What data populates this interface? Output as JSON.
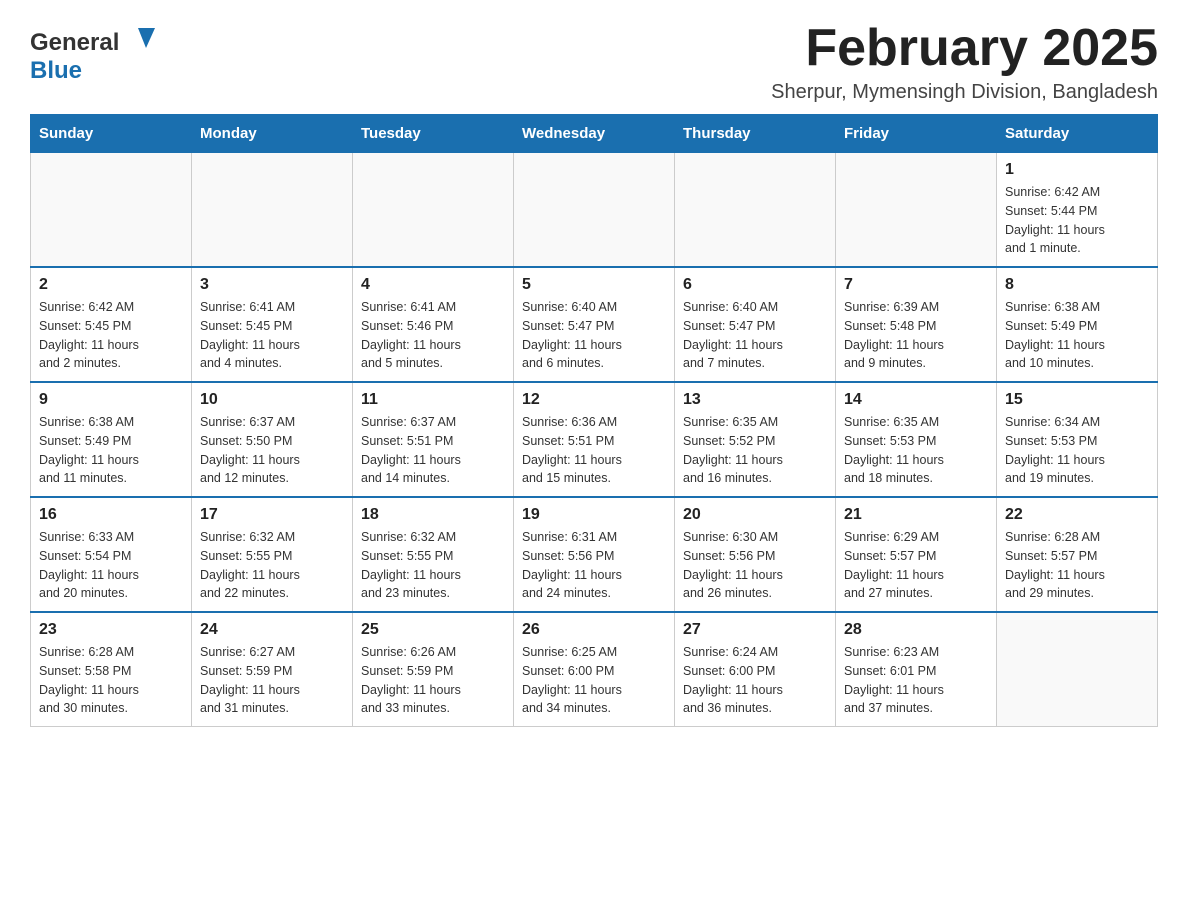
{
  "header": {
    "logo_general": "General",
    "logo_blue": "Blue",
    "title": "February 2025",
    "subtitle": "Sherpur, Mymensingh Division, Bangladesh"
  },
  "calendar": {
    "days_of_week": [
      "Sunday",
      "Monday",
      "Tuesday",
      "Wednesday",
      "Thursday",
      "Friday",
      "Saturday"
    ],
    "weeks": [
      [
        {
          "day": "",
          "info": ""
        },
        {
          "day": "",
          "info": ""
        },
        {
          "day": "",
          "info": ""
        },
        {
          "day": "",
          "info": ""
        },
        {
          "day": "",
          "info": ""
        },
        {
          "day": "",
          "info": ""
        },
        {
          "day": "1",
          "info": "Sunrise: 6:42 AM\nSunset: 5:44 PM\nDaylight: 11 hours\nand 1 minute."
        }
      ],
      [
        {
          "day": "2",
          "info": "Sunrise: 6:42 AM\nSunset: 5:45 PM\nDaylight: 11 hours\nand 2 minutes."
        },
        {
          "day": "3",
          "info": "Sunrise: 6:41 AM\nSunset: 5:45 PM\nDaylight: 11 hours\nand 4 minutes."
        },
        {
          "day": "4",
          "info": "Sunrise: 6:41 AM\nSunset: 5:46 PM\nDaylight: 11 hours\nand 5 minutes."
        },
        {
          "day": "5",
          "info": "Sunrise: 6:40 AM\nSunset: 5:47 PM\nDaylight: 11 hours\nand 6 minutes."
        },
        {
          "day": "6",
          "info": "Sunrise: 6:40 AM\nSunset: 5:47 PM\nDaylight: 11 hours\nand 7 minutes."
        },
        {
          "day": "7",
          "info": "Sunrise: 6:39 AM\nSunset: 5:48 PM\nDaylight: 11 hours\nand 9 minutes."
        },
        {
          "day": "8",
          "info": "Sunrise: 6:38 AM\nSunset: 5:49 PM\nDaylight: 11 hours\nand 10 minutes."
        }
      ],
      [
        {
          "day": "9",
          "info": "Sunrise: 6:38 AM\nSunset: 5:49 PM\nDaylight: 11 hours\nand 11 minutes."
        },
        {
          "day": "10",
          "info": "Sunrise: 6:37 AM\nSunset: 5:50 PM\nDaylight: 11 hours\nand 12 minutes."
        },
        {
          "day": "11",
          "info": "Sunrise: 6:37 AM\nSunset: 5:51 PM\nDaylight: 11 hours\nand 14 minutes."
        },
        {
          "day": "12",
          "info": "Sunrise: 6:36 AM\nSunset: 5:51 PM\nDaylight: 11 hours\nand 15 minutes."
        },
        {
          "day": "13",
          "info": "Sunrise: 6:35 AM\nSunset: 5:52 PM\nDaylight: 11 hours\nand 16 minutes."
        },
        {
          "day": "14",
          "info": "Sunrise: 6:35 AM\nSunset: 5:53 PM\nDaylight: 11 hours\nand 18 minutes."
        },
        {
          "day": "15",
          "info": "Sunrise: 6:34 AM\nSunset: 5:53 PM\nDaylight: 11 hours\nand 19 minutes."
        }
      ],
      [
        {
          "day": "16",
          "info": "Sunrise: 6:33 AM\nSunset: 5:54 PM\nDaylight: 11 hours\nand 20 minutes."
        },
        {
          "day": "17",
          "info": "Sunrise: 6:32 AM\nSunset: 5:55 PM\nDaylight: 11 hours\nand 22 minutes."
        },
        {
          "day": "18",
          "info": "Sunrise: 6:32 AM\nSunset: 5:55 PM\nDaylight: 11 hours\nand 23 minutes."
        },
        {
          "day": "19",
          "info": "Sunrise: 6:31 AM\nSunset: 5:56 PM\nDaylight: 11 hours\nand 24 minutes."
        },
        {
          "day": "20",
          "info": "Sunrise: 6:30 AM\nSunset: 5:56 PM\nDaylight: 11 hours\nand 26 minutes."
        },
        {
          "day": "21",
          "info": "Sunrise: 6:29 AM\nSunset: 5:57 PM\nDaylight: 11 hours\nand 27 minutes."
        },
        {
          "day": "22",
          "info": "Sunrise: 6:28 AM\nSunset: 5:57 PM\nDaylight: 11 hours\nand 29 minutes."
        }
      ],
      [
        {
          "day": "23",
          "info": "Sunrise: 6:28 AM\nSunset: 5:58 PM\nDaylight: 11 hours\nand 30 minutes."
        },
        {
          "day": "24",
          "info": "Sunrise: 6:27 AM\nSunset: 5:59 PM\nDaylight: 11 hours\nand 31 minutes."
        },
        {
          "day": "25",
          "info": "Sunrise: 6:26 AM\nSunset: 5:59 PM\nDaylight: 11 hours\nand 33 minutes."
        },
        {
          "day": "26",
          "info": "Sunrise: 6:25 AM\nSunset: 6:00 PM\nDaylight: 11 hours\nand 34 minutes."
        },
        {
          "day": "27",
          "info": "Sunrise: 6:24 AM\nSunset: 6:00 PM\nDaylight: 11 hours\nand 36 minutes."
        },
        {
          "day": "28",
          "info": "Sunrise: 6:23 AM\nSunset: 6:01 PM\nDaylight: 11 hours\nand 37 minutes."
        },
        {
          "day": "",
          "info": ""
        }
      ]
    ]
  }
}
